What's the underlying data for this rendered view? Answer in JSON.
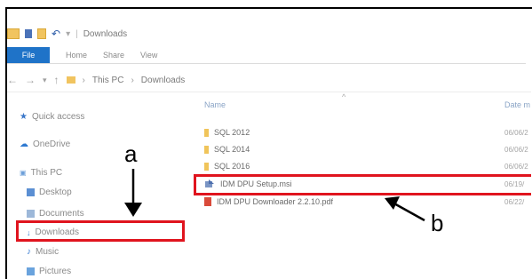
{
  "window": {
    "title": "Downloads",
    "ribbon_tabs": [
      "File",
      "Home",
      "Share",
      "View"
    ]
  },
  "address_bar": {
    "path": [
      "This PC",
      "Downloads"
    ]
  },
  "sidebar": {
    "items": [
      {
        "label": "Quick access",
        "icon": "star-icon"
      },
      {
        "label": "OneDrive",
        "icon": "cloud-icon"
      },
      {
        "label": "This PC",
        "icon": "computer-icon"
      },
      {
        "label": "Desktop",
        "icon": "desktop-icon"
      },
      {
        "label": "Documents",
        "icon": "documents-icon"
      },
      {
        "label": "Downloads",
        "icon": "download-icon",
        "selected": true
      },
      {
        "label": "Music",
        "icon": "music-icon"
      },
      {
        "label": "Pictures",
        "icon": "pictures-icon"
      }
    ]
  },
  "file_list": {
    "columns": [
      "Name",
      "Date m"
    ],
    "files": [
      {
        "name": "SQL 2012",
        "type": "folder",
        "date": "06/06/2"
      },
      {
        "name": "SQL 2014",
        "type": "folder",
        "date": "06/06/2"
      },
      {
        "name": "SQL 2016",
        "type": "folder",
        "date": "06/06/2"
      },
      {
        "name": "IDM DPU Setup.msi",
        "type": "installer",
        "date": "06/19/"
      },
      {
        "name": "IDM DPU Downloader 2.2.10.pdf",
        "type": "pdf",
        "date": "06/22/"
      }
    ]
  },
  "annotations": {
    "label_a": "a",
    "label_b": "b",
    "highlight_color": "#e0141e"
  }
}
